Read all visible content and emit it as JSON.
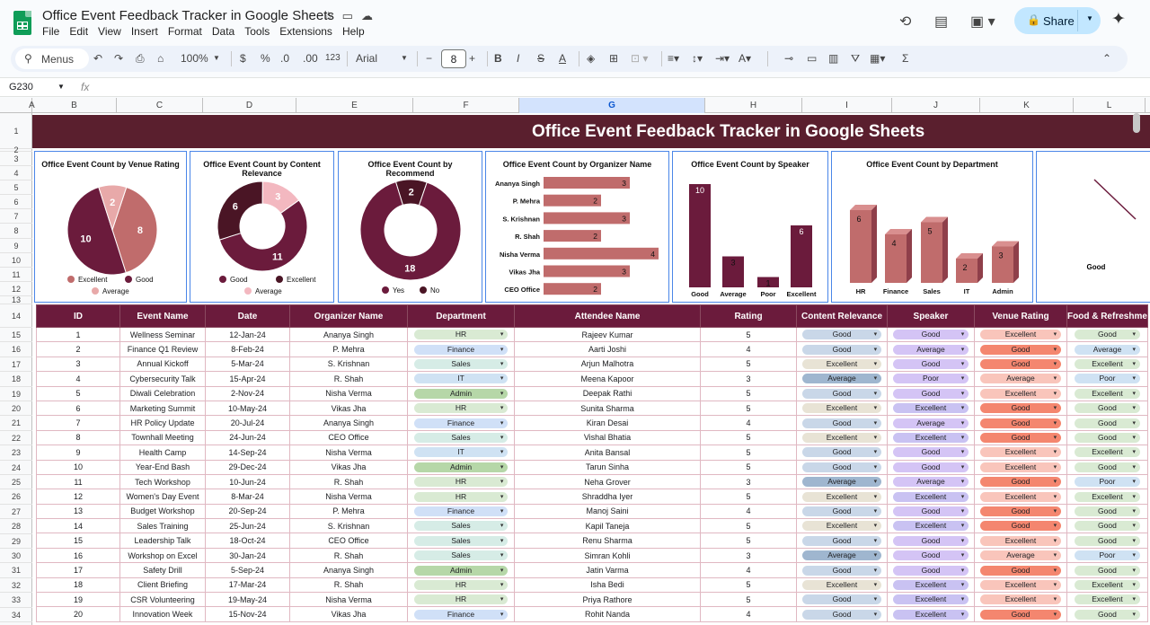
{
  "app": {
    "doc_title": "Office Event Feedback Tracker in Google Sheets",
    "menu": [
      "File",
      "Edit",
      "View",
      "Insert",
      "Format",
      "Data",
      "Tools",
      "Extensions",
      "Help"
    ],
    "share_label": "Share"
  },
  "toolbar": {
    "search_label": "Menus",
    "zoom": "100%",
    "currency": "$",
    "percent": "%",
    "dec_decrease": ".0",
    "dec_increase": ".00",
    "number_format": "123",
    "font": "Arial",
    "font_size": "8"
  },
  "formula_bar": {
    "cell_ref": "G230",
    "fx": "fx"
  },
  "columns": [
    "A",
    "B",
    "C",
    "D",
    "E",
    "F",
    "G",
    "H",
    "I",
    "J",
    "K",
    "L"
  ],
  "selected_column": "G",
  "rows": [
    "1",
    "2",
    "3",
    "4",
    "5",
    "6",
    "7",
    "8",
    "9",
    "10",
    "11",
    "12",
    "13",
    "14",
    "15",
    "16",
    "17",
    "18",
    "19",
    "20",
    "21",
    "22",
    "23",
    "24",
    "25",
    "26",
    "27",
    "28",
    "29",
    "30",
    "31",
    "32",
    "33",
    "34"
  ],
  "banner": {
    "title": "Office Event Feedback Tracker in Google Sheets"
  },
  "colors": {
    "dark": "#6b1b3c",
    "mid": "#c06c6c",
    "light": "#f3b8c0",
    "banner": "#5a1f2e"
  },
  "chart_data": [
    {
      "type": "pie",
      "title": "Office Event Count by Venue Rating",
      "categories": [
        "Excellent",
        "Good",
        "Average"
      ],
      "values": [
        8,
        10,
        2
      ],
      "colors": [
        "#c06c6c",
        "#6b1b3c",
        "#e8a9a9"
      ]
    },
    {
      "type": "pie",
      "title": "Office Event Count by Content Relevance",
      "donut": true,
      "categories": [
        "Good",
        "Excellent",
        "Average"
      ],
      "values": [
        11,
        6,
        3
      ],
      "colors": [
        "#6b1b3c",
        "#4a1525",
        "#f3b8c0"
      ]
    },
    {
      "type": "pie",
      "title": "Office Event Count by Recommend",
      "donut": true,
      "categories": [
        "Yes",
        "No"
      ],
      "values": [
        18,
        2
      ],
      "colors": [
        "#6b1b3c",
        "#4a1525"
      ]
    },
    {
      "type": "bar",
      "orientation": "horizontal",
      "title": "Office Event Count by Organizer Name",
      "categories": [
        "Ananya Singh",
        "P. Mehra",
        "S. Krishnan",
        "R. Shah",
        "Nisha Verma",
        "Vikas Jha",
        "CEO Office"
      ],
      "values": [
        3,
        2,
        3,
        2,
        4,
        3,
        2
      ]
    },
    {
      "type": "bar",
      "title": "Office Event Count by Speaker",
      "categories": [
        "Good",
        "Average",
        "Poor",
        "Excellent"
      ],
      "values": [
        10,
        3,
        1,
        6
      ]
    },
    {
      "type": "bar",
      "title": "Office Event Count by Department",
      "style": "3d",
      "categories": [
        "HR",
        "Finance",
        "Sales",
        "IT",
        "Admin"
      ],
      "values": [
        6,
        4,
        5,
        2,
        3
      ]
    }
  ],
  "table": {
    "headers": [
      "ID",
      "Event Name",
      "Date",
      "Organizer Name",
      "Department",
      "Attendee Name",
      "Rating",
      "Content Relevance",
      "Speaker",
      "Venue Rating",
      "Food & Refreshme"
    ],
    "rows": [
      [
        "1",
        "Wellness Seminar",
        "12-Jan-24",
        "Ananya Singh",
        "HR",
        "Rajeev Kumar",
        "5",
        "Good",
        "Good",
        "Excellent",
        "Good"
      ],
      [
        "2",
        "Finance Q1 Review",
        "8-Feb-24",
        "P. Mehra",
        "Finance",
        "Aarti Joshi",
        "4",
        "Good",
        "Average",
        "Good",
        "Average"
      ],
      [
        "3",
        "Annual Kickoff",
        "5-Mar-24",
        "S. Krishnan",
        "Sales",
        "Arjun Malhotra",
        "5",
        "Excellent",
        "Good",
        "Good",
        "Excellent"
      ],
      [
        "4",
        "Cybersecurity Talk",
        "15-Apr-24",
        "R. Shah",
        "IT",
        "Meena Kapoor",
        "3",
        "Average",
        "Poor",
        "Average",
        "Poor"
      ],
      [
        "5",
        "Diwali Celebration",
        "2-Nov-24",
        "Nisha Verma",
        "Admin",
        "Deepak Rathi",
        "5",
        "Good",
        "Good",
        "Excellent",
        "Excellent"
      ],
      [
        "6",
        "Marketing Summit",
        "10-May-24",
        "Vikas Jha",
        "HR",
        "Sunita Sharma",
        "5",
        "Excellent",
        "Excellent",
        "Good",
        "Good"
      ],
      [
        "7",
        "HR Policy Update",
        "20-Jul-24",
        "Ananya Singh",
        "Finance",
        "Kiran Desai",
        "4",
        "Good",
        "Average",
        "Good",
        "Good"
      ],
      [
        "8",
        "Townhall Meeting",
        "24-Jun-24",
        "CEO Office",
        "Sales",
        "Vishal Bhatia",
        "5",
        "Excellent",
        "Excellent",
        "Good",
        "Good"
      ],
      [
        "9",
        "Health Camp",
        "14-Sep-24",
        "Nisha Verma",
        "IT",
        "Anita Bansal",
        "5",
        "Good",
        "Good",
        "Excellent",
        "Excellent"
      ],
      [
        "10",
        "Year-End Bash",
        "29-Dec-24",
        "Vikas Jha",
        "Admin",
        "Tarun Sinha",
        "5",
        "Good",
        "Good",
        "Excellent",
        "Good"
      ],
      [
        "11",
        "Tech Workshop",
        "10-Jun-24",
        "R. Shah",
        "HR",
        "Neha Grover",
        "3",
        "Average",
        "Average",
        "Good",
        "Poor"
      ],
      [
        "12",
        "Women's Day Event",
        "8-Mar-24",
        "Nisha Verma",
        "HR",
        "Shraddha Iyer",
        "5",
        "Excellent",
        "Excellent",
        "Excellent",
        "Excellent"
      ],
      [
        "13",
        "Budget Workshop",
        "20-Sep-24",
        "P. Mehra",
        "Finance",
        "Manoj Saini",
        "4",
        "Good",
        "Good",
        "Good",
        "Good"
      ],
      [
        "14",
        "Sales Training",
        "25-Jun-24",
        "S. Krishnan",
        "Sales",
        "Kapil Taneja",
        "5",
        "Excellent",
        "Excellent",
        "Good",
        "Good"
      ],
      [
        "15",
        "Leadership Talk",
        "18-Oct-24",
        "CEO Office",
        "Sales",
        "Renu Sharma",
        "5",
        "Good",
        "Good",
        "Excellent",
        "Good"
      ],
      [
        "16",
        "Workshop on Excel",
        "30-Jan-24",
        "R. Shah",
        "Sales",
        "Simran Kohli",
        "3",
        "Average",
        "Good",
        "Average",
        "Poor"
      ],
      [
        "17",
        "Safety Drill",
        "5-Sep-24",
        "Ananya Singh",
        "Admin",
        "Jatin Varma",
        "4",
        "Good",
        "Good",
        "Good",
        "Good"
      ],
      [
        "18",
        "Client Briefing",
        "17-Mar-24",
        "R. Shah",
        "HR",
        "Isha Bedi",
        "5",
        "Excellent",
        "Excellent",
        "Excellent",
        "Excellent"
      ],
      [
        "19",
        "CSR Volunteering",
        "19-May-24",
        "Nisha Verma",
        "HR",
        "Priya Rathore",
        "5",
        "Good",
        "Excellent",
        "Excellent",
        "Excellent"
      ],
      [
        "20",
        "Innovation Week",
        "15-Nov-24",
        "Vikas Jha",
        "Finance",
        "Rohit Nanda",
        "4",
        "Good",
        "Excellent",
        "Good",
        "Good"
      ]
    ]
  }
}
